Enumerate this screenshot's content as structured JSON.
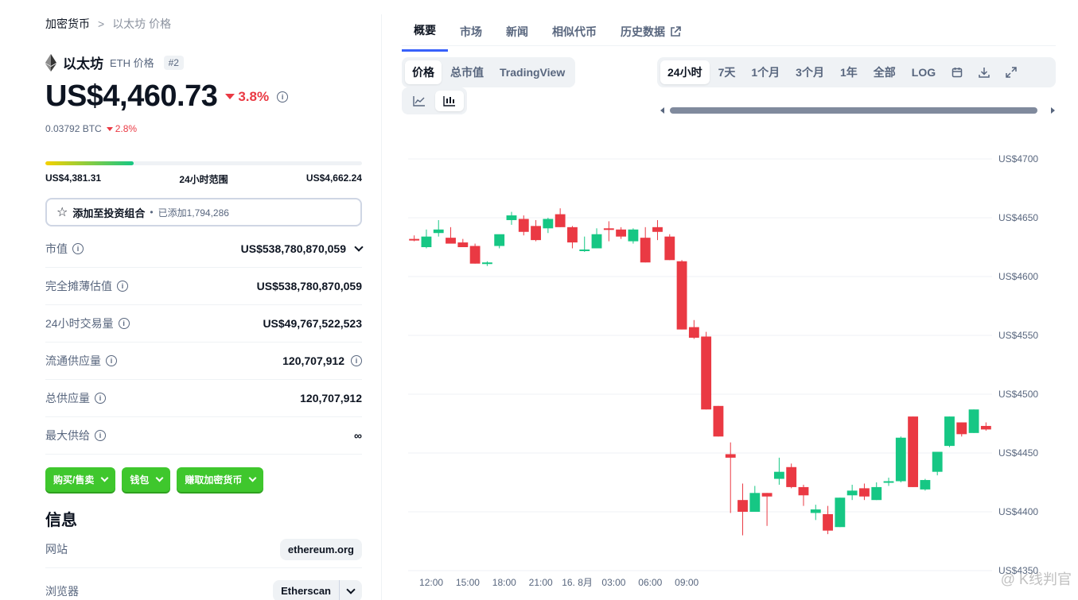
{
  "breadcrumb": {
    "root": "加密货币",
    "sep": ">",
    "current": "以太坊 价格"
  },
  "coin": {
    "name": "以太坊",
    "symbol": "ETH 价格",
    "rank": "#2"
  },
  "price": {
    "value": "US$4,460.73",
    "change": "3.8%",
    "btc": "0.03792 BTC",
    "btc_change": "2.8%"
  },
  "range": {
    "low": "US$4,381.31",
    "label": "24小时范围",
    "high": "US$4,662.24",
    "position_pct": 28
  },
  "portfolio": {
    "label": "添加至投资组合",
    "dot": "•",
    "added": "已添加1,794,286"
  },
  "stats": [
    {
      "label": "市值",
      "value": "US$538,780,870,059"
    },
    {
      "label": "完全摊薄估值",
      "value": "US$538,780,870,059"
    },
    {
      "label": "24小时交易量",
      "value": "US$49,767,522,523"
    },
    {
      "label": "流通供应量",
      "value": "120,707,912"
    },
    {
      "label": "总供应量",
      "value": "120,707,912"
    },
    {
      "label": "最大供给",
      "value": "∞"
    }
  ],
  "buttons": {
    "buy": "购买/售卖",
    "wallet": "钱包",
    "earn": "赚取加密货币"
  },
  "info": {
    "title": "信息",
    "website_label": "网站",
    "website_value": "ethereum.org",
    "explorer_label": "浏览器",
    "explorer_value": "Etherscan"
  },
  "tabs": [
    "概要",
    "市场",
    "新闻",
    "相似代币",
    "历史数据"
  ],
  "chart_types": [
    "价格",
    "总市值",
    "TradingView"
  ],
  "ranges": [
    "24小时",
    "7天",
    "1个月",
    "3个月",
    "1年",
    "全部",
    "LOG"
  ],
  "icons": {
    "calendar": "calendar-icon",
    "download": "download-icon",
    "fullscreen": "fullscreen-icon",
    "line": "line-chart-icon",
    "candle": "candlestick-icon",
    "info": "info-icon",
    "star": "star-icon",
    "external": "external-link-icon"
  },
  "colors": {
    "up": "#16c784",
    "down": "#ea3943",
    "accent": "#3861fb",
    "green_btn": "#3fc72d"
  },
  "watermark": "@ K线判官",
  "chart_data": {
    "type": "candlestick",
    "ylim": [
      4350,
      4700
    ],
    "y_ticks": [
      4700,
      4650,
      4600,
      4550,
      4500,
      4450,
      4400,
      4350
    ],
    "y_tick_labels": [
      "US$4700",
      "US$4650",
      "US$4600",
      "US$4550",
      "US$4500",
      "US$4450",
      "US$4400",
      "US$4350"
    ],
    "x_ticks": [
      "12:00",
      "15:00",
      "18:00",
      "21:00",
      "16. 8月",
      "03:00",
      "06:00",
      "09:00"
    ],
    "x_tick_pos": [
      1.4,
      4.4,
      7.4,
      10.4,
      13.4,
      16.4,
      19.4,
      22.4
    ],
    "candles": [
      [
        4632,
        4635,
        4630,
        4631
      ],
      [
        4625,
        4640,
        4624,
        4634
      ],
      [
        4637,
        4648,
        4634,
        4640
      ],
      [
        4633,
        4642,
        4631,
        4628
      ],
      [
        4629,
        4632,
        4626,
        4625
      ],
      [
        4626,
        4628,
        4611,
        4611
      ],
      [
        4611,
        4613,
        4609,
        4612
      ],
      [
        4626,
        4630,
        4624,
        4636
      ],
      [
        4648,
        4655,
        4644,
        4652
      ],
      [
        4649,
        4652,
        4635,
        4638
      ],
      [
        4643,
        4648,
        4630,
        4631
      ],
      [
        4641,
        4650,
        4637,
        4649
      ],
      [
        4653,
        4658,
        4642,
        4642
      ],
      [
        4642,
        4643,
        4624,
        4629
      ],
      [
        4623,
        4634,
        4621,
        4623
      ],
      [
        4624,
        4641,
        4624,
        4636
      ],
      [
        4641,
        4647,
        4630,
        4640
      ],
      [
        4640,
        4642,
        4632,
        4634
      ],
      [
        4630,
        4641,
        4628,
        4640
      ],
      [
        4633,
        4642,
        4612,
        4612
      ],
      [
        4642,
        4648,
        4631,
        4638
      ],
      [
        4634,
        4636,
        4614,
        4614
      ],
      [
        4613,
        4614,
        4555,
        4555
      ],
      [
        4557,
        4563,
        4547,
        4548
      ],
      [
        4549,
        4553,
        4487,
        4487
      ],
      [
        4490,
        4490,
        4464,
        4464
      ],
      [
        4449,
        4459,
        4399,
        4446
      ],
      [
        4410,
        4424,
        4380,
        4400
      ],
      [
        4400,
        4422,
        4400,
        4416
      ],
      [
        4416,
        4416,
        4388,
        4413
      ],
      [
        4428,
        4446,
        4423,
        4434
      ],
      [
        4438,
        4441,
        4420,
        4421
      ],
      [
        4421,
        4423,
        4405,
        4414
      ],
      [
        4399,
        4406,
        4393,
        4402
      ],
      [
        4398,
        4405,
        4381,
        4384
      ],
      [
        4387,
        4412,
        4387,
        4412
      ],
      [
        4414,
        4423,
        4410,
        4418
      ],
      [
        4420,
        4424,
        4410,
        4413
      ],
      [
        4410,
        4425,
        4410,
        4421
      ],
      [
        4425,
        4429,
        4422,
        4426
      ],
      [
        4426,
        4464,
        4425,
        4463
      ],
      [
        4481,
        4481,
        4421,
        4421
      ],
      [
        4419,
        4428,
        4418,
        4427
      ],
      [
        4434,
        4451,
        4431,
        4451
      ],
      [
        4456,
        4481,
        4455,
        4481
      ],
      [
        4476,
        4476,
        4464,
        4466
      ],
      [
        4467,
        4487,
        4467,
        4487
      ],
      [
        4473,
        4476,
        4469,
        4470
      ]
    ]
  }
}
